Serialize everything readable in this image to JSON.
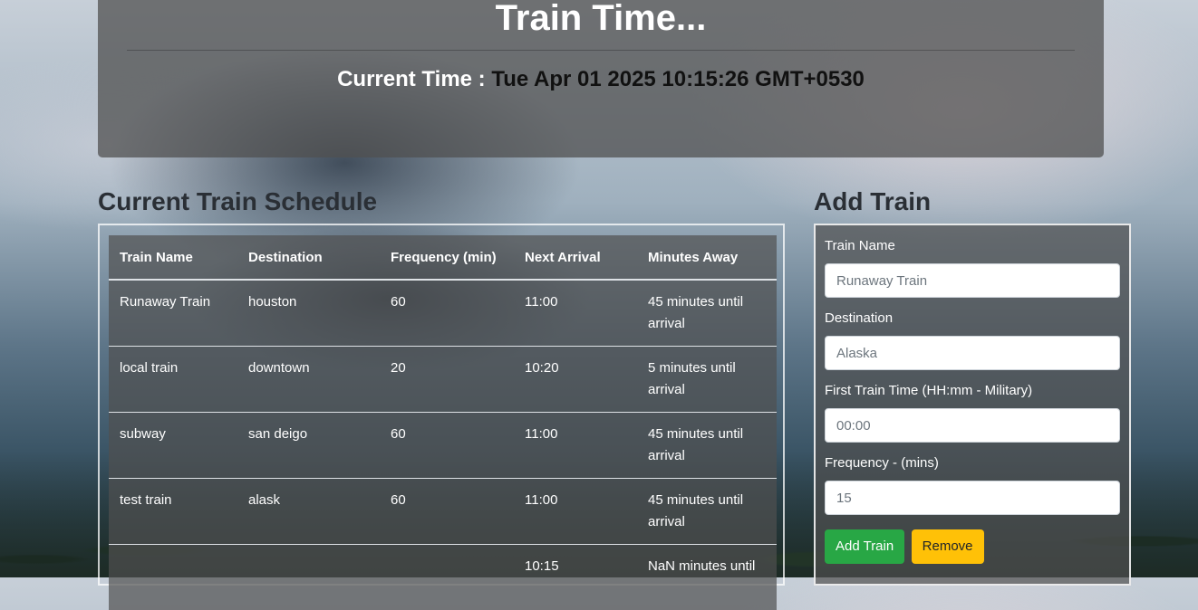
{
  "header": {
    "title": "Train Time...",
    "current_time_label": "Current Time :",
    "current_time_value": "Tue Apr 01 2025 10:15:26 GMT+0530"
  },
  "schedule": {
    "heading": "Current Train Schedule",
    "columns": [
      "Train Name",
      "Destination",
      "Frequency (min)",
      "Next Arrival",
      "Minutes Away"
    ],
    "rows": [
      [
        "Runaway Train",
        "houston",
        "60",
        "11:00",
        "45 minutes until arrival"
      ],
      [
        "local train",
        "downtown",
        "20",
        "10:20",
        "5 minutes until arrival"
      ],
      [
        "subway",
        "san deigo",
        "60",
        "11:00",
        "45 minutes until arrival"
      ],
      [
        "test train",
        "alask",
        "60",
        "11:00",
        "45 minutes until arrival"
      ],
      [
        "",
        "",
        "",
        "10:15",
        "NaN minutes until"
      ]
    ]
  },
  "add_train": {
    "heading": "Add Train",
    "train_name_label": "Train Name",
    "train_name_placeholder": "Runaway Train",
    "destination_label": "Destination",
    "destination_placeholder": "Alaska",
    "first_time_label": "First Train Time (HH:mm - Military)",
    "first_time_placeholder": "00:00",
    "frequency_label": "Frequency - (mins)",
    "frequency_placeholder": "15",
    "add_button": "Add Train",
    "remove_button": "Remove"
  },
  "colors": {
    "add_button": "#28a745",
    "remove_button": "#ffc107"
  }
}
